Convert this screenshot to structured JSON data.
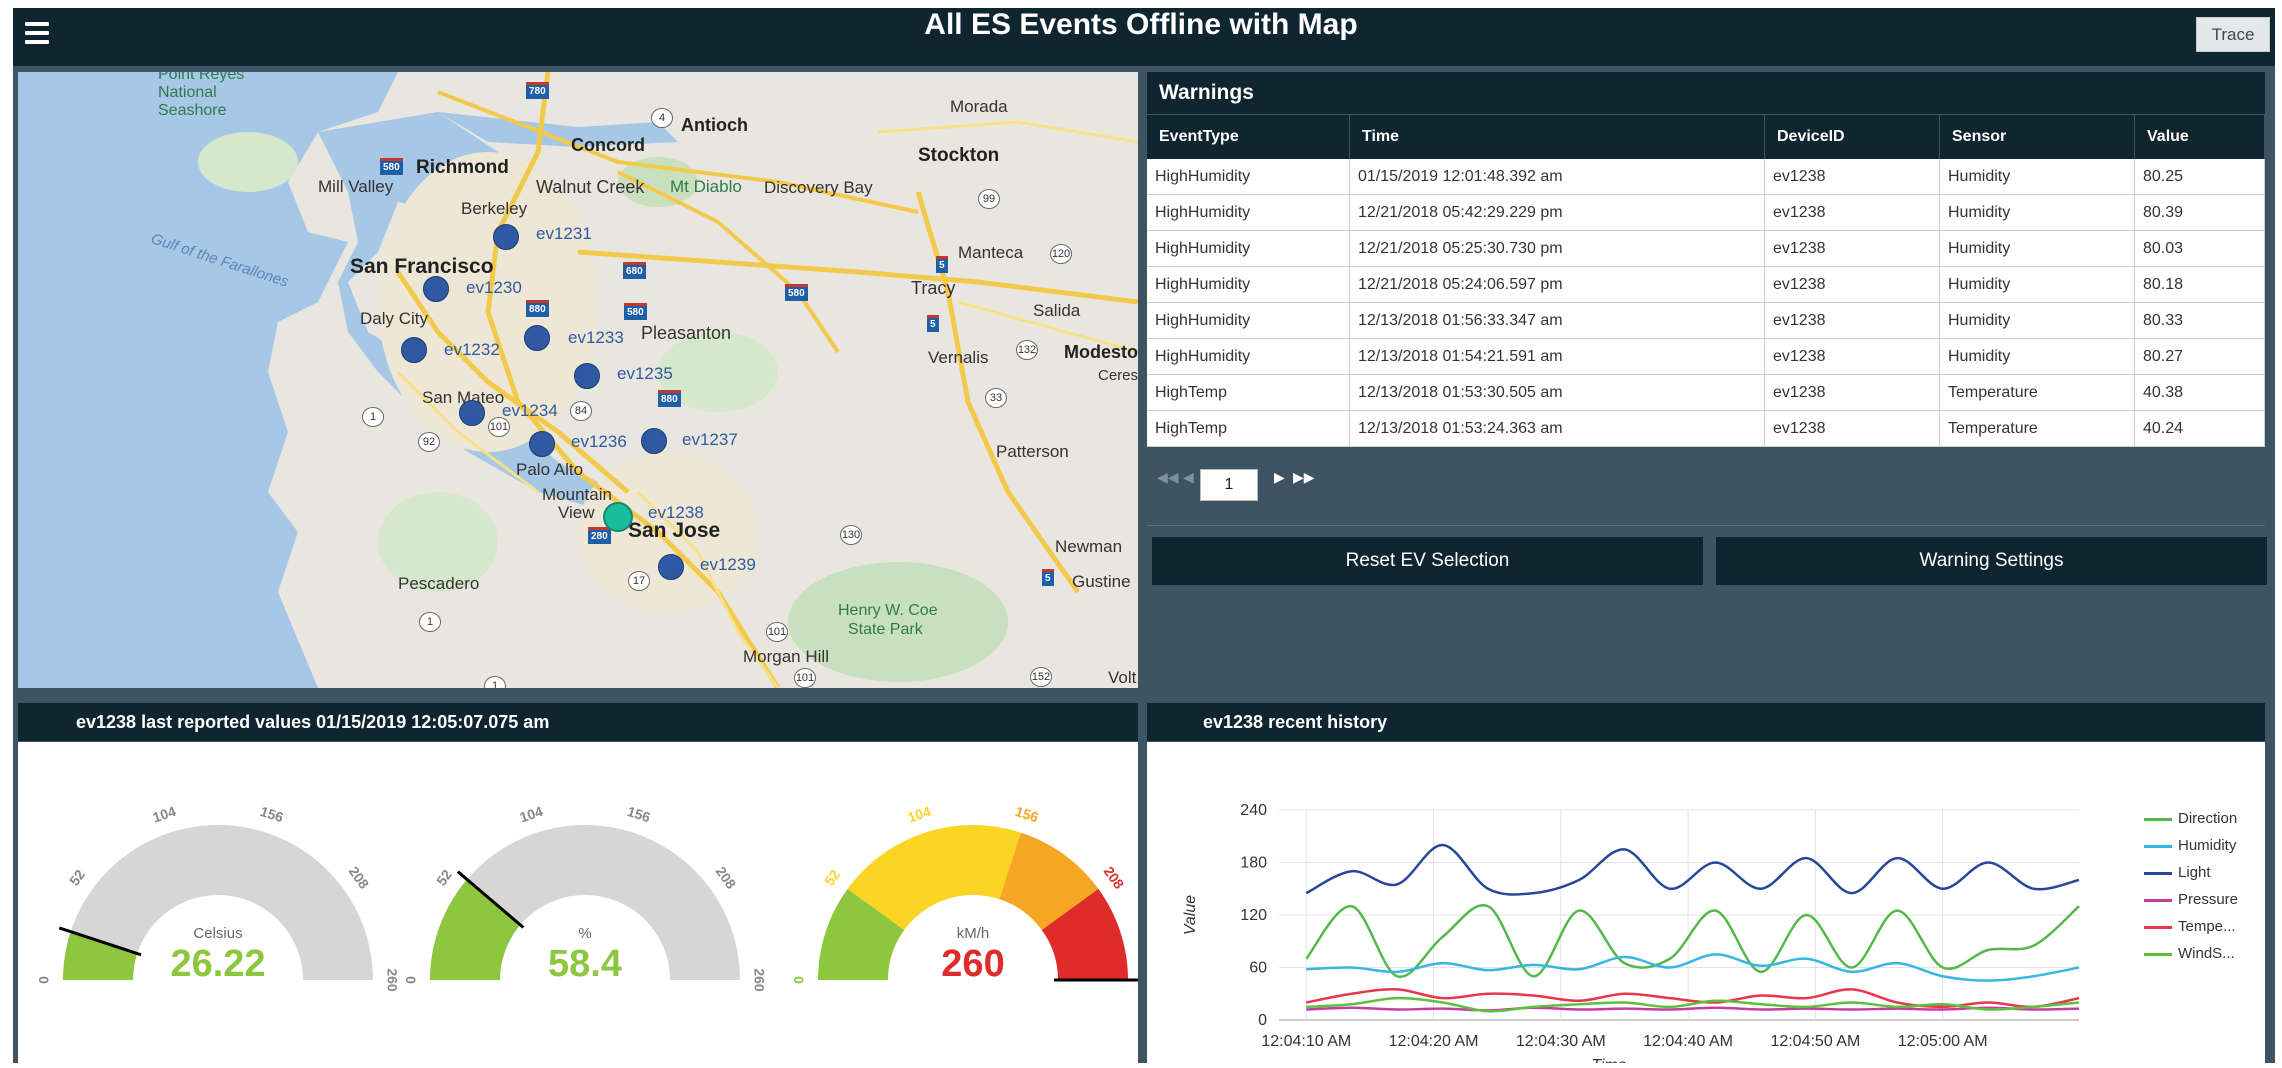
{
  "header": {
    "title": "All ES Events Offline with Map",
    "trace_label": "Trace"
  },
  "map": {
    "places": [
      "Point Reyes",
      "National",
      "Seashore",
      "Richmond",
      "Mill Valley",
      "Concord",
      "Antioch",
      "Morada",
      "Stockton",
      "Walnut Creek",
      "Mt Diablo",
      "Discovery Bay",
      "Berkeley",
      "Gulf of the Farallones",
      "San Francisco",
      "Manteca",
      "Tracy",
      "Daly City",
      "Salida",
      "Pleasanton",
      "Vernalis",
      "Modesto",
      "Ceres",
      "San Mateo",
      "Palo Alto",
      "Patterson",
      "Mountain",
      "View",
      "San Jose",
      "Newman",
      "Gustine",
      "Pescadero",
      "Henry W. Coe",
      "State Park",
      "Morgan Hill",
      "Volt"
    ],
    "markers": [
      "ev1231",
      "ev1230",
      "ev1232",
      "ev1233",
      "ev1235",
      "ev1234",
      "ev1236",
      "ev1237",
      "ev1238",
      "ev1239"
    ],
    "selected_marker": "ev1238",
    "shields": [
      "780",
      "4",
      "580",
      "680",
      "880",
      "580",
      "99",
      "580",
      "5",
      "120",
      "5",
      "132",
      "33",
      "880",
      "84",
      "101",
      "92",
      "1",
      "280",
      "130",
      "5",
      "17",
      "1",
      "101",
      "152",
      "101",
      "1"
    ]
  },
  "warnings": {
    "title": "Warnings",
    "columns": [
      "EventType",
      "Time",
      "DeviceID",
      "Sensor",
      "Value"
    ],
    "rows": [
      [
        "HighHumidity",
        "01/15/2019 12:01:48.392 am",
        "ev1238",
        "Humidity",
        "80.25"
      ],
      [
        "HighHumidity",
        "12/21/2018 05:42:29.229 pm",
        "ev1238",
        "Humidity",
        "80.39"
      ],
      [
        "HighHumidity",
        "12/21/2018 05:25:30.730 pm",
        "ev1238",
        "Humidity",
        "80.03"
      ],
      [
        "HighHumidity",
        "12/21/2018 05:24:06.597 pm",
        "ev1238",
        "Humidity",
        "80.18"
      ],
      [
        "HighHumidity",
        "12/13/2018 01:56:33.347 am",
        "ev1238",
        "Humidity",
        "80.33"
      ],
      [
        "HighHumidity",
        "12/13/2018 01:54:21.591 am",
        "ev1238",
        "Humidity",
        "80.27"
      ],
      [
        "HighTemp",
        "12/13/2018 01:53:30.505 am",
        "ev1238",
        "Temperature",
        "40.38"
      ],
      [
        "HighTemp",
        "12/13/2018 01:53:24.363 am",
        "ev1238",
        "Temperature",
        "40.24"
      ]
    ],
    "page": "1"
  },
  "actions": {
    "reset_label": "Reset EV Selection",
    "settings_label": "Warning Settings"
  },
  "gauges_panel": {
    "title": "ev1238 last reported values 01/15/2019 12:05:07.075 am",
    "gauges": [
      {
        "unit": "Celsius",
        "value": "26.22",
        "raw": 26.22,
        "min": 0,
        "max": 260,
        "ticks": [
          "0",
          "52",
          "104",
          "156",
          "208",
          "260"
        ],
        "style": "gray",
        "value_color": "#8dc63f"
      },
      {
        "unit": "%",
        "value": "58.4",
        "raw": 58.4,
        "min": 0,
        "max": 260,
        "ticks": [
          "0",
          "52",
          "104",
          "156",
          "208",
          "260"
        ],
        "style": "gray",
        "value_color": "#8dc63f"
      },
      {
        "unit": "kM/h",
        "value": "260",
        "raw": 260,
        "min": 0,
        "max": 260,
        "ticks": [
          "0",
          "52",
          "104",
          "156",
          "208",
          "260"
        ],
        "style": "bands",
        "value_color": "#e02b2b"
      }
    ],
    "colors": {
      "green": "#8dc63f",
      "yellow": "#fbd424",
      "orange": "#f5a623",
      "red": "#e02b2b",
      "gray": "#d6d6d6"
    }
  },
  "history_panel": {
    "title": "ev1238 recent history"
  },
  "chart_data": {
    "type": "line",
    "ylabel": "Value",
    "xlabel": "Time",
    "ylim": [
      0,
      240
    ],
    "yticks": [
      "0",
      "60",
      "120",
      "180",
      "240"
    ],
    "xticks": [
      "12:04:10 AM",
      "12:04:20 AM",
      "12:04:30 AM",
      "12:04:40 AM",
      "12:04:50 AM",
      "12:05:00 AM"
    ],
    "x_seconds": [
      0,
      5,
      10,
      15,
      20,
      25,
      30,
      35,
      40,
      45,
      50,
      55,
      60,
      65,
      70,
      75,
      80,
      85
    ],
    "grid": true,
    "legend_position": "right",
    "series": [
      {
        "name": "Direction",
        "color": "#55b84a",
        "values": [
          70,
          130,
          50,
          95,
          130,
          50,
          125,
          65,
          70,
          125,
          55,
          120,
          60,
          125,
          60,
          80,
          85,
          130
        ]
      },
      {
        "name": "Humidity",
        "color": "#35b7e0",
        "values": [
          58,
          60,
          55,
          65,
          57,
          63,
          58,
          72,
          60,
          75,
          62,
          70,
          55,
          65,
          50,
          45,
          50,
          60
        ]
      },
      {
        "name": "Light",
        "color": "#27479b",
        "values": [
          145,
          170,
          155,
          200,
          150,
          145,
          160,
          195,
          150,
          180,
          150,
          185,
          145,
          185,
          150,
          180,
          150,
          160
        ]
      },
      {
        "name": "Pressure",
        "color": "#c43ea0",
        "values": [
          12,
          14,
          12,
          13,
          11,
          14,
          12,
          13,
          12,
          14,
          12,
          13,
          12,
          13,
          12,
          14,
          12,
          13
        ]
      },
      {
        "name": "Tempe...",
        "color": "#e8364f",
        "values": [
          20,
          30,
          35,
          25,
          30,
          28,
          22,
          30,
          25,
          20,
          28,
          25,
          35,
          20,
          15,
          20,
          15,
          25
        ]
      },
      {
        "name": "WindS...",
        "color": "#5fbf3f",
        "values": [
          15,
          18,
          25,
          20,
          10,
          15,
          18,
          20,
          15,
          22,
          18,
          15,
          20,
          15,
          18,
          12,
          15,
          20
        ]
      }
    ]
  }
}
